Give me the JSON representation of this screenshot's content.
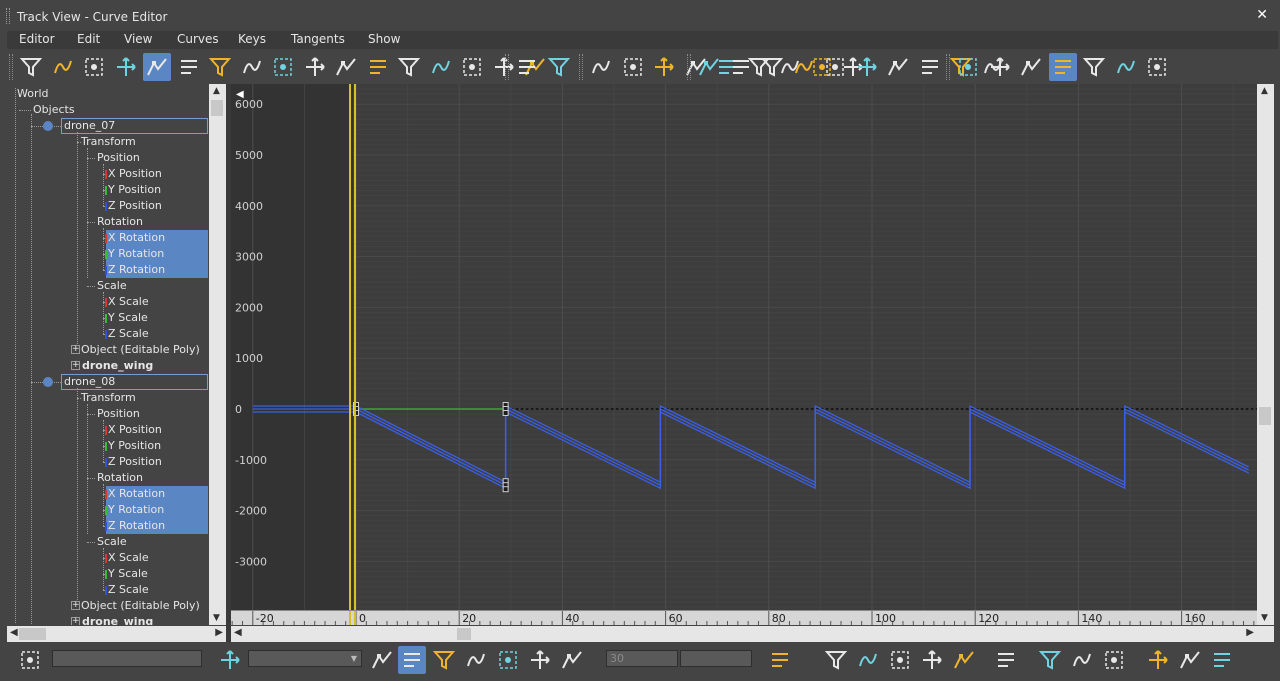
{
  "window": {
    "title": "Track View - Curve Editor"
  },
  "menu": [
    "Editor",
    "Edit",
    "View",
    "Curves",
    "Keys",
    "Tangents",
    "Show"
  ],
  "toolbar_icons": [
    "filter-icon",
    "lock-selection-icon",
    "snap-frames-icon",
    "move-keys-icon",
    "slide-keys-icon",
    "add-keys-icon",
    "region-tool-icon",
    "retime-tool-icon",
    "parameter-curve-icon",
    "ease-curve-icon",
    "multiplier-curve-icon",
    "out-of-range-constant-icon",
    "out-of-range-cycle-icon",
    "out-of-range-loop-icon",
    "out-of-range-pingpong-icon",
    "select-keys-icon",
    "key-modifier-icon",
    "key-stats-icon",
    "tangent-auto-icon",
    "tangent-spline-icon",
    "tangent-fast-icon",
    "tangent-slow-icon",
    "tangent-step-icon",
    "tangent-linear-icon",
    "tangent-smooth-icon",
    "break-tangents-icon",
    "unify-tangents-icon",
    "align-keys-icon",
    "delete-keys-icon",
    "show-tangents-icon",
    "frame-all-icon",
    "scale-values-icon",
    "zoom-region-icon",
    "custom-tangent-icon",
    "bezier-tangent-icon",
    "transform-keys-icon",
    "smooth-keys-icon",
    "link-keys-icon",
    "spline-tangent-icon",
    "linear-tangent-icon",
    "corner-tangent-icon",
    "isolate-curve-icon",
    "show-all-tangents-icon",
    "tangent-angle-icon",
    "snap-key-icon"
  ],
  "tree": {
    "world": "World",
    "objects": "Objects",
    "nodes": [
      {
        "name": "drone_07",
        "transform": "Transform",
        "position": "Position",
        "x_position": "X Position",
        "y_position": "Y Position",
        "z_position": "Z Position",
        "rotation": "Rotation",
        "x_rotation": "X Rotation",
        "y_rotation": "Y Rotation",
        "z_rotation": "Z Rotation",
        "scale": "Scale",
        "x_scale": "X Scale",
        "y_scale": "Y Scale",
        "z_scale": "Z Scale",
        "object": "Object (Editable Poly)",
        "child": "drone_wing"
      },
      {
        "name": "drone_08",
        "transform": "Transform",
        "position": "Position",
        "x_position": "X Position",
        "y_position": "Y Position",
        "z_position": "Z Position",
        "rotation": "Rotation",
        "x_rotation": "X Rotation",
        "y_rotation": "Y Rotation",
        "z_rotation": "Z Rotation",
        "scale": "Scale",
        "x_scale": "X Scale",
        "y_scale": "Y Scale",
        "z_scale": "Z Scale",
        "object": "Object (Editable Poly)",
        "child": "drone_wing"
      }
    ]
  },
  "graph": {
    "y_ticks": [
      "6000",
      "5000",
      "4000",
      "3000",
      "2000",
      "1000",
      "0",
      "-1000",
      "-2000",
      "-3000"
    ],
    "x_ticks": [
      "-20",
      "0",
      "20",
      "40",
      "60",
      "80",
      "100",
      "120",
      "140",
      "160"
    ],
    "current_frame": 0,
    "curve": {
      "x": [
        -20,
        0,
        29,
        29,
        59,
        59,
        89,
        89,
        119,
        119,
        149,
        149,
        173
      ],
      "y": [
        0,
        0,
        -1500,
        0,
        -1500,
        0,
        -1500,
        0,
        -1500,
        0,
        -1500,
        0,
        -1200
      ]
    },
    "colors": {
      "curve": "#3b5fe6",
      "current_frame": "#d6c02a",
      "selected": "#5b86c4"
    }
  },
  "status": {
    "frame_value": "30",
    "icons": [
      "zoom-icon",
      "filter-list-icon",
      "show-selected-icon",
      "show-keyable-icon",
      "show-animated-icon",
      "show-visible-icon",
      "show-locked-icon",
      "key-info-icon",
      "frame-icon",
      "zoom-h-icon",
      "zoom-v-icon",
      "pan-icon",
      "hand-icon",
      "zoom-extents-icon",
      "zoom-extents-selected-icon",
      "zoom-region-icon",
      "magnify-icon",
      "zoom-value-icon",
      "isolate-icon"
    ]
  }
}
